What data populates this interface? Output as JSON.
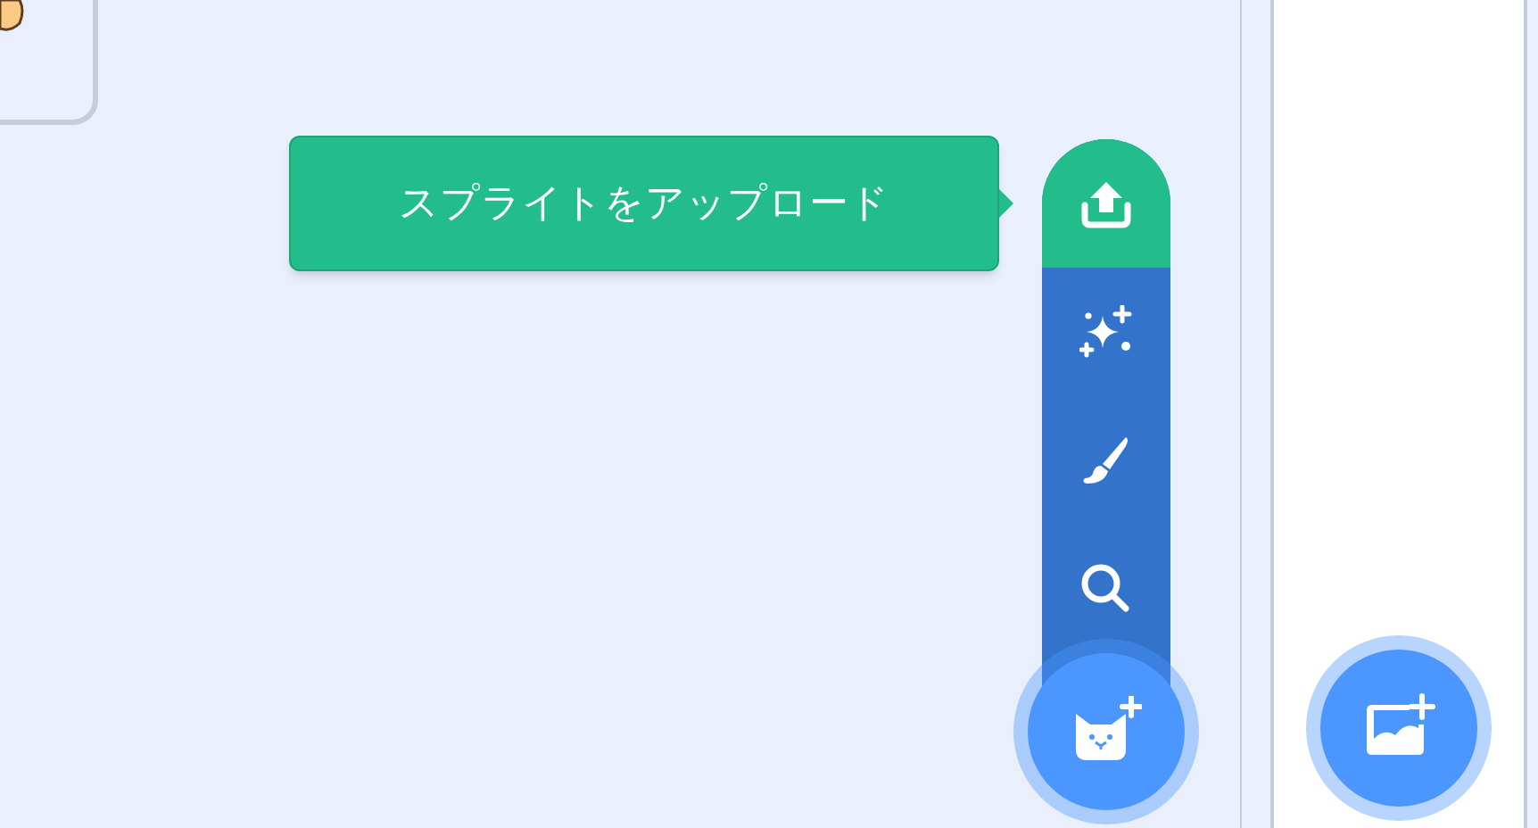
{
  "tooltip": {
    "text": "スプライトをアップロード"
  },
  "sprite_menu": [
    {
      "kind": "upload",
      "selected": true
    },
    {
      "kind": "surprise",
      "selected": false
    },
    {
      "kind": "paint",
      "selected": false
    },
    {
      "kind": "search",
      "selected": false
    }
  ],
  "sprite_button": {
    "kind": "sprite"
  },
  "backdrop_button": {
    "kind": "backdrop"
  }
}
